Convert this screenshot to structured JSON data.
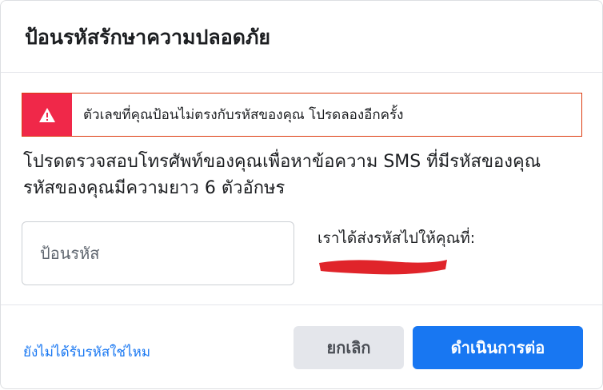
{
  "dialog": {
    "title": "ป้อนรหัสรักษาความปลอดภัย",
    "error": {
      "icon": "warning-icon",
      "message": "ตัวเลขที่คุณป้อนไม่ตรงกับรหัสของคุณ โปรดลองอีกครั้ง",
      "color": "#f02849"
    },
    "instruction": "โปรดตรวจสอบโทรศัพท์ของคุณเพื่อหาข้อความ SMS ที่มีรหัสของคุณ รหัสของคุณมีความยาว 6 ตัวอักษร",
    "code_input": {
      "placeholder": "ป้อนรหัส",
      "value": ""
    },
    "sent_to_label": "เราได้ส่งรหัสไปให้คุณที่:",
    "footer": {
      "no_code_link": "ยังไม่ได้รับรหัสใช่ไหม",
      "cancel_label": "ยกเลิก",
      "continue_label": "ดำเนินการต่อ"
    },
    "colors": {
      "primary": "#1877f2",
      "error": "#f02849",
      "redaction": "#e0242a"
    }
  }
}
